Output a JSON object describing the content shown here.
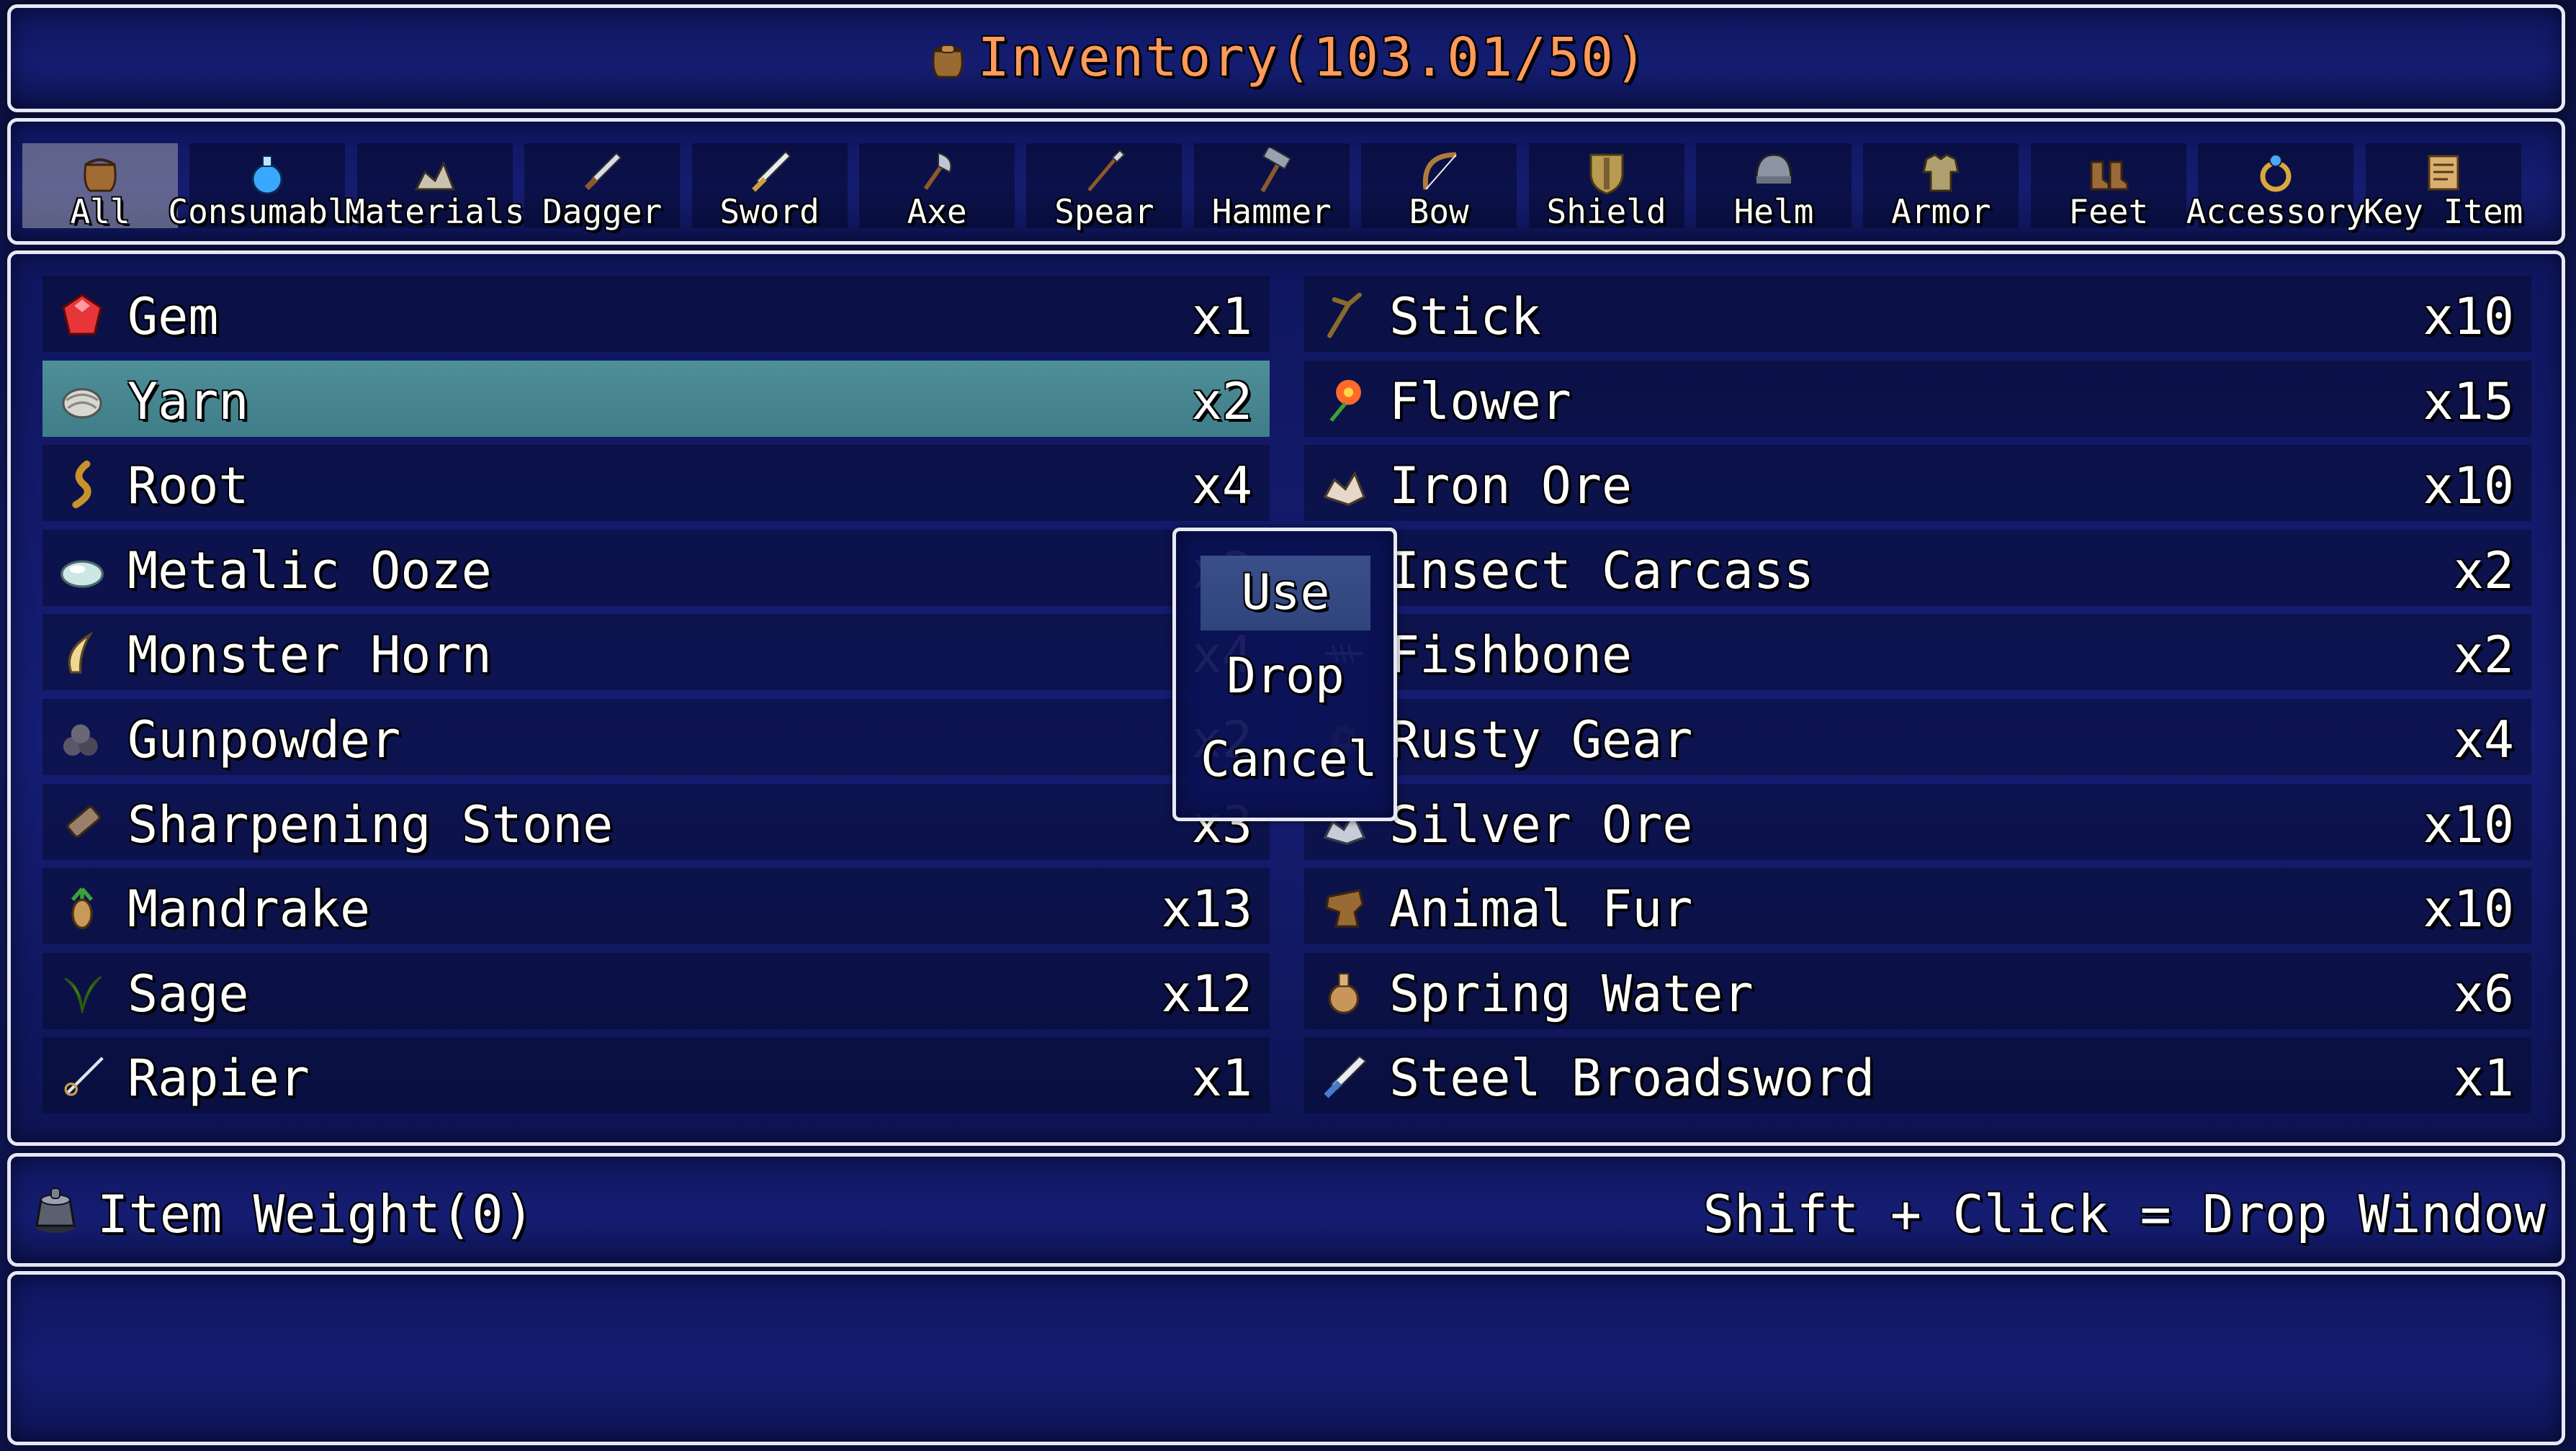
{
  "title": {
    "text": "Inventory(103.01/50)",
    "color": "#ff9a5c"
  },
  "tabs": [
    {
      "label": "All",
      "icon": "bag-icon",
      "active": true
    },
    {
      "label": "Consumable",
      "icon": "potion-icon",
      "active": false
    },
    {
      "label": "Materials",
      "icon": "ore-pile-icon",
      "active": false
    },
    {
      "label": "Dagger",
      "icon": "dagger-icon",
      "active": false
    },
    {
      "label": "Sword",
      "icon": "sword-icon",
      "active": false
    },
    {
      "label": "Axe",
      "icon": "axe-icon",
      "active": false
    },
    {
      "label": "Spear",
      "icon": "spear-icon",
      "active": false
    },
    {
      "label": "Hammer",
      "icon": "hammer-icon",
      "active": false
    },
    {
      "label": "Bow",
      "icon": "bow-icon",
      "active": false
    },
    {
      "label": "Shield",
      "icon": "shield-icon",
      "active": false
    },
    {
      "label": "Helm",
      "icon": "helm-icon",
      "active": false
    },
    {
      "label": "Armor",
      "icon": "armor-icon",
      "active": false
    },
    {
      "label": "Feet",
      "icon": "boots-icon",
      "active": false
    },
    {
      "label": "Accessory",
      "icon": "ring-icon",
      "active": false
    },
    {
      "label": "Key Item",
      "icon": "scroll-icon",
      "active": false
    }
  ],
  "items_left": [
    {
      "name": "Gem",
      "qty": "x1",
      "icon": "gem-icon"
    },
    {
      "name": "Yarn",
      "qty": "x2",
      "icon": "yarn-icon",
      "selected": true
    },
    {
      "name": "Root",
      "qty": "x4",
      "icon": "root-icon"
    },
    {
      "name": "Metalic Ooze",
      "qty": "x2",
      "icon": "ooze-icon"
    },
    {
      "name": "Monster Horn",
      "qty": "x4",
      "icon": "horn-icon"
    },
    {
      "name": "Gunpowder",
      "qty": "x2",
      "icon": "gunpowder-icon"
    },
    {
      "name": "Sharpening Stone",
      "qty": "x3",
      "icon": "whetstone-icon"
    },
    {
      "name": "Mandrake",
      "qty": "x13",
      "icon": "mandrake-icon"
    },
    {
      "name": "Sage",
      "qty": "x12",
      "icon": "herb-icon"
    },
    {
      "name": "Rapier",
      "qty": "x1",
      "icon": "rapier-icon"
    }
  ],
  "items_right": [
    {
      "name": "Stick",
      "qty": "x10",
      "icon": "stick-icon"
    },
    {
      "name": "Flower",
      "qty": "x15",
      "icon": "flower-icon"
    },
    {
      "name": "Iron Ore",
      "qty": "x10",
      "icon": "iron-ore-icon"
    },
    {
      "name": "Insect Carcass",
      "qty": "x2",
      "icon": "insect-icon"
    },
    {
      "name": "Fishbone",
      "qty": "x2",
      "icon": "fishbone-icon"
    },
    {
      "name": "Rusty Gear",
      "qty": "x4",
      "icon": "gear-icon"
    },
    {
      "name": "Silver Ore",
      "qty": "x10",
      "icon": "silver-ore-icon"
    },
    {
      "name": "Animal Fur",
      "qty": "x10",
      "icon": "fur-icon"
    },
    {
      "name": "Spring Water",
      "qty": "x6",
      "icon": "water-flask-icon"
    },
    {
      "name": "Steel Broadsword",
      "qty": "x1",
      "icon": "broadsword-icon"
    }
  ],
  "command_menu": {
    "options": [
      "Use",
      "Drop",
      "Cancel"
    ],
    "selected_index": 0
  },
  "status_bar": {
    "weight_label": "Item Weight(0)",
    "hint": "Shift + Click = Drop Window",
    "icon": "weight-icon"
  },
  "colors": {
    "title": "#ff9a5c",
    "selection": "#4f8f98",
    "window_border": "#e6e9f5"
  }
}
